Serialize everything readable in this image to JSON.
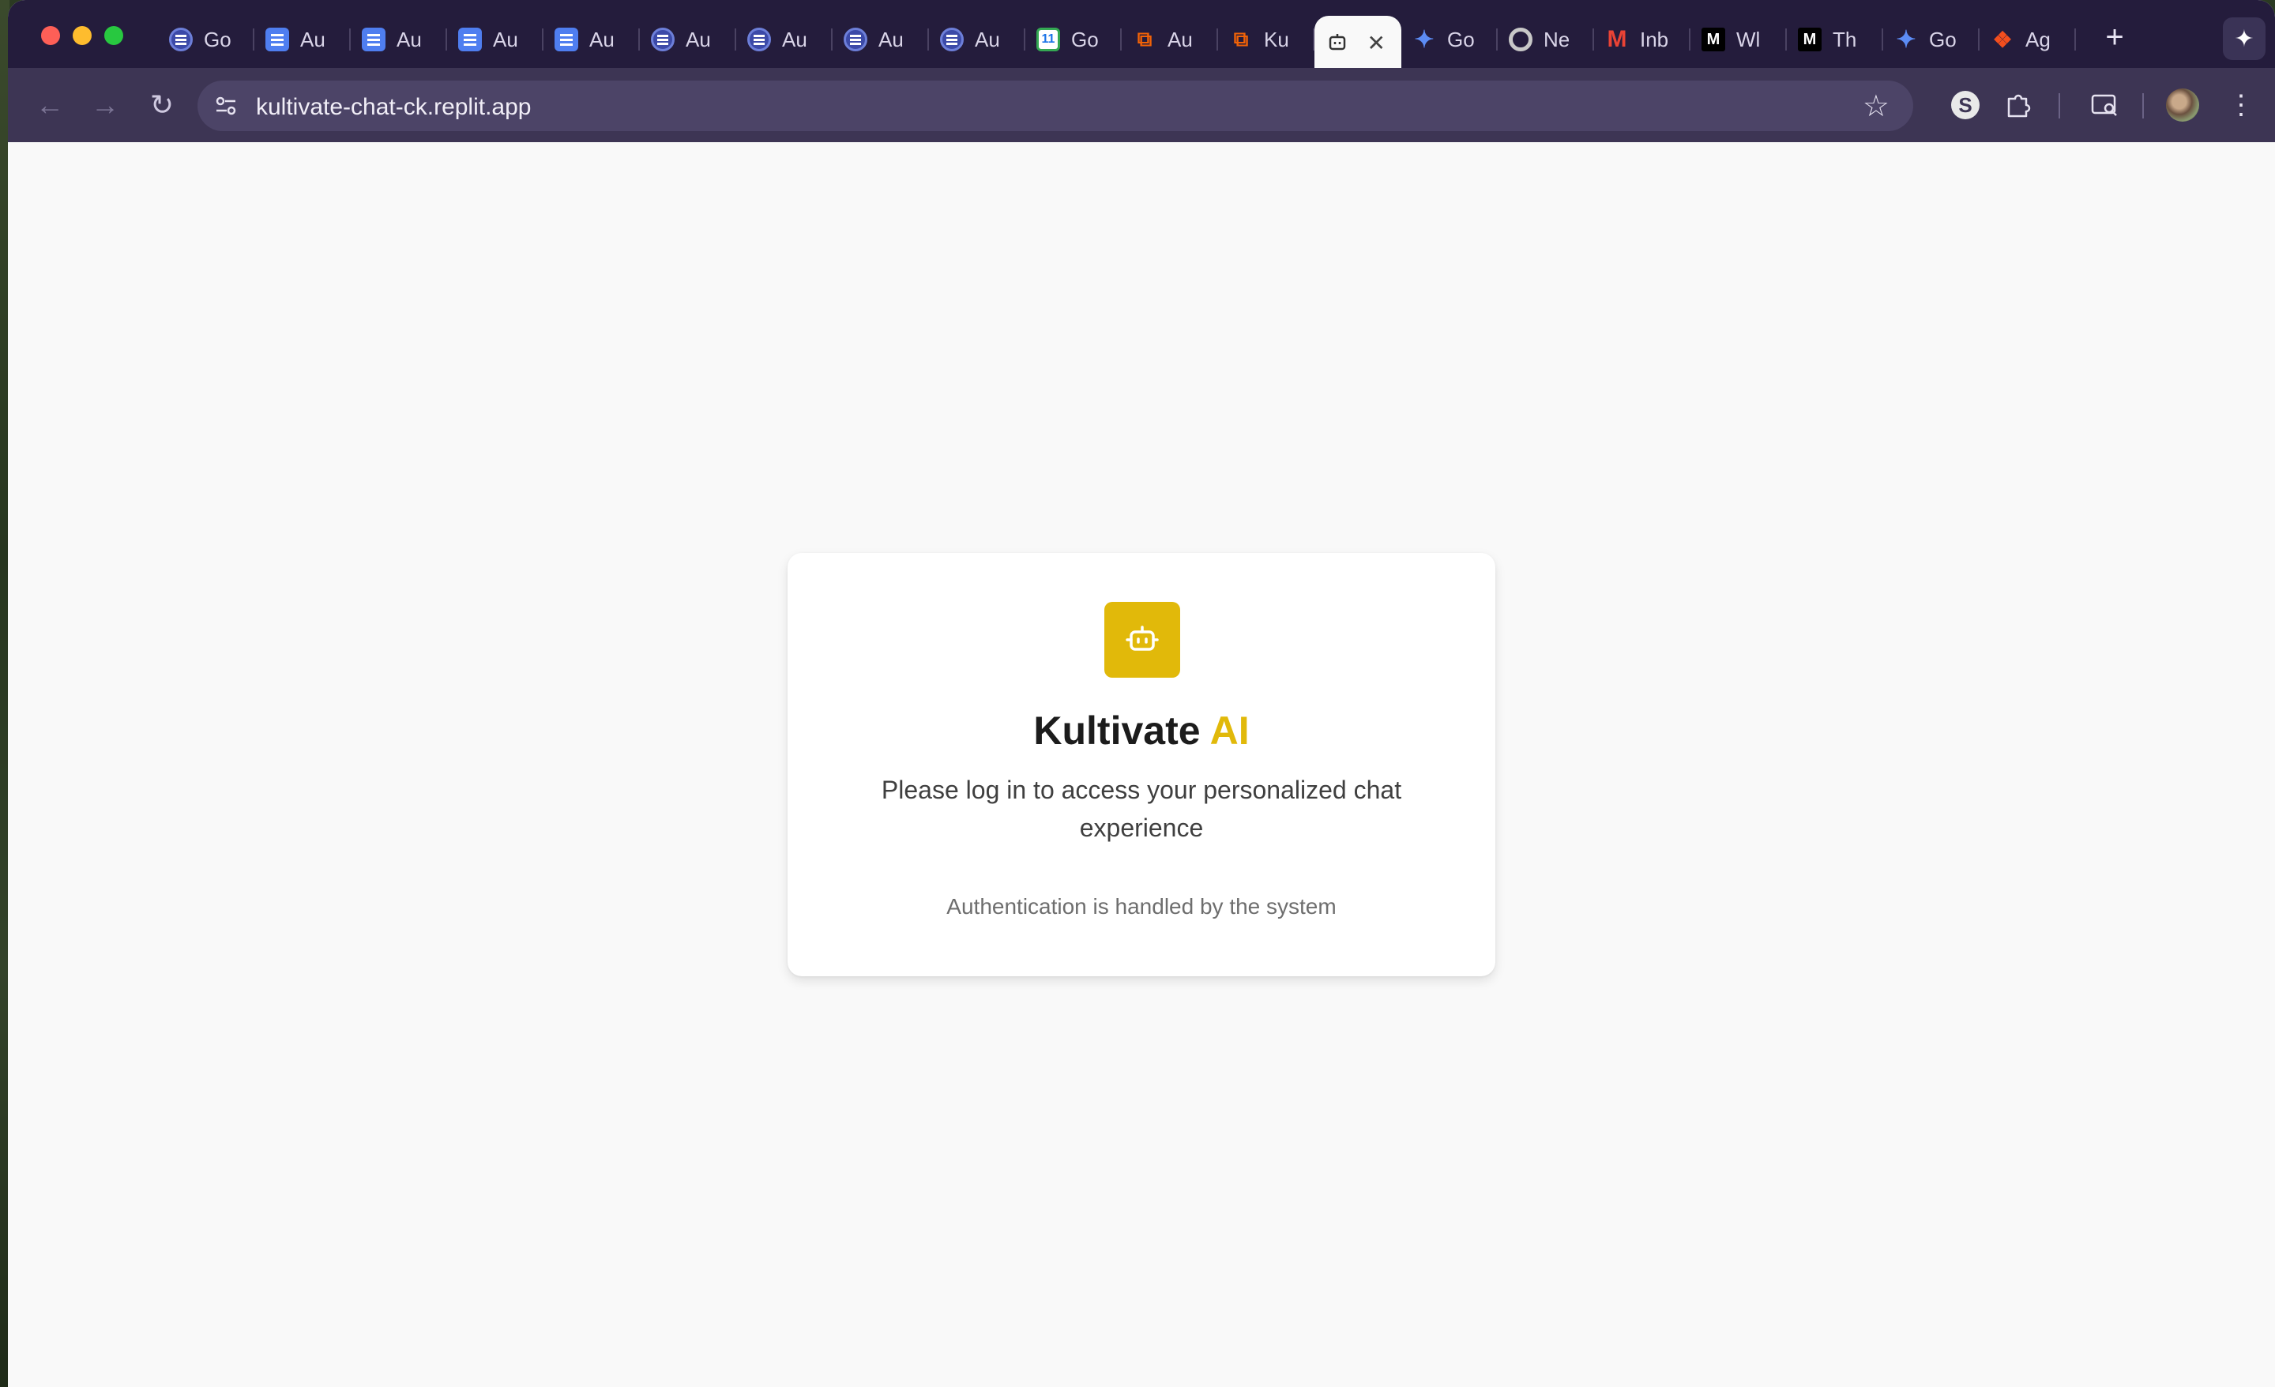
{
  "browser": {
    "tabs": [
      {
        "label": "Go",
        "icon": "gemini-ring-icon",
        "kind": "ring"
      },
      {
        "label": "Au",
        "icon": "docs-icon",
        "kind": "doc"
      },
      {
        "label": "Au",
        "icon": "docs-icon",
        "kind": "doc"
      },
      {
        "label": "Au",
        "icon": "docs-icon",
        "kind": "doc"
      },
      {
        "label": "Au",
        "icon": "docs-icon",
        "kind": "doc"
      },
      {
        "label": "Au",
        "icon": "docs-ring-icon",
        "kind": "ring"
      },
      {
        "label": "Au",
        "icon": "docs-ring-icon",
        "kind": "ring"
      },
      {
        "label": "Au",
        "icon": "docs-ring-icon",
        "kind": "ring"
      },
      {
        "label": "Au",
        "icon": "docs-ring-icon",
        "kind": "ring"
      },
      {
        "label": "Go",
        "icon": "calendar-icon",
        "kind": "cal",
        "glyph": "11"
      },
      {
        "label": "Au",
        "icon": "replit-icon",
        "kind": "rep"
      },
      {
        "label": "Ku",
        "icon": "replit-icon",
        "kind": "rep"
      },
      {
        "label": "",
        "icon": "robot-icon",
        "kind": "robot",
        "active": true
      },
      {
        "label": "Go",
        "icon": "gemini-star-icon",
        "kind": "gem"
      },
      {
        "label": "Ne",
        "icon": "chrome-icon",
        "kind": "chrome"
      },
      {
        "label": "Inb",
        "icon": "gmail-icon",
        "kind": "gmail"
      },
      {
        "label": "Wl",
        "icon": "medium-icon",
        "kind": "medium",
        "glyph": "M"
      },
      {
        "label": "Th",
        "icon": "medium-icon",
        "kind": "medium",
        "glyph": "M"
      },
      {
        "label": "Go",
        "icon": "gemini-star-icon",
        "kind": "gem"
      },
      {
        "label": "Ag",
        "icon": "figma-icon",
        "kind": "figma"
      }
    ],
    "url": "kultivate-chat-ck.replit.app"
  },
  "card": {
    "title_main": "Kultivate",
    "title_accent": "AI",
    "subtitle": "Please log in to access your personalized chat experience",
    "note": "Authentication is handled by the system"
  },
  "colors": {
    "accent": "#e1b90a",
    "tabstrip": "#241c3c",
    "toolbar": "#3d3554",
    "page_bg": "#f9f9f9"
  }
}
